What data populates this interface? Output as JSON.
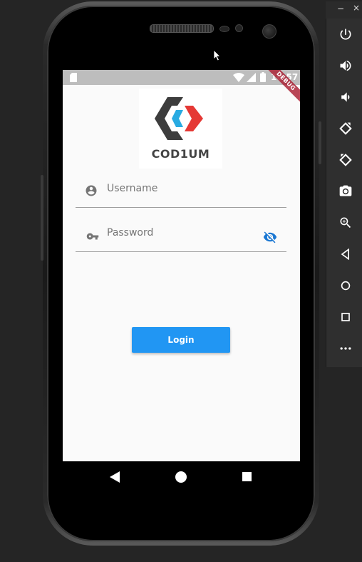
{
  "status_bar": {
    "time": "10:57"
  },
  "debug_banner": {
    "label": "DEBUG"
  },
  "logo": {
    "text": "COD1UM",
    "colors": {
      "dark": "#3d3d3d",
      "cyan": "#29abe2",
      "red": "#e53935"
    }
  },
  "form": {
    "username": {
      "placeholder": "Username",
      "value": "",
      "icon": "account-circle-icon"
    },
    "password": {
      "placeholder": "Password",
      "value": "",
      "icon": "key-icon",
      "toggle_icon": "visibility-off-icon"
    }
  },
  "login_button": {
    "label": "Login",
    "color": "#2196f3"
  },
  "android_nav": {
    "items": [
      "back-icon",
      "home-icon",
      "recents-icon"
    ]
  },
  "emulator_toolbar": {
    "window_controls": {
      "minimize": "−",
      "close": "×"
    },
    "buttons": [
      "power-icon",
      "volume-up-icon",
      "volume-down-icon",
      "rotate-left-icon",
      "rotate-right-icon",
      "screenshot-icon",
      "zoom-icon",
      "back-icon",
      "home-icon",
      "overview-icon",
      "more-icon"
    ]
  }
}
